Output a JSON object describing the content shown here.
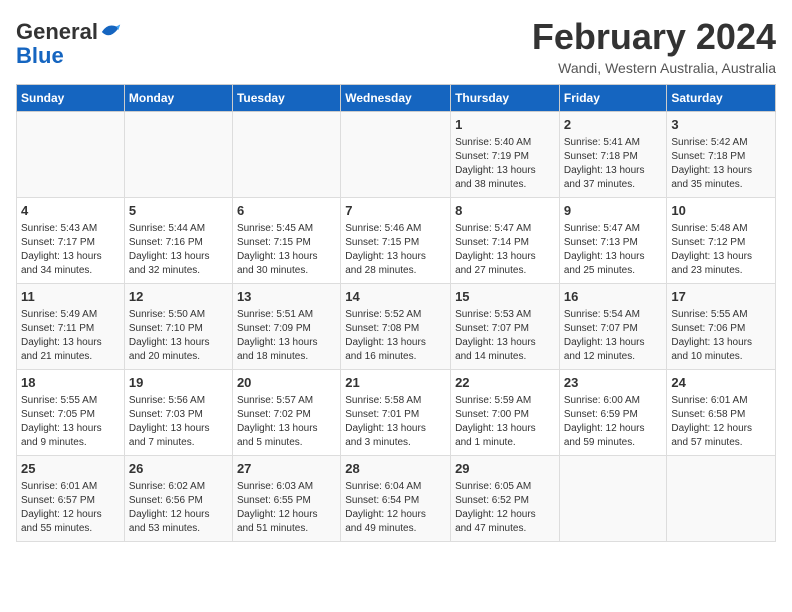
{
  "header": {
    "logo_general": "General",
    "logo_blue": "Blue",
    "month_year": "February 2024",
    "location": "Wandi, Western Australia, Australia"
  },
  "days_of_week": [
    "Sunday",
    "Monday",
    "Tuesday",
    "Wednesday",
    "Thursday",
    "Friday",
    "Saturday"
  ],
  "weeks": [
    [
      {
        "day": "",
        "info": ""
      },
      {
        "day": "",
        "info": ""
      },
      {
        "day": "",
        "info": ""
      },
      {
        "day": "",
        "info": ""
      },
      {
        "day": "1",
        "info": "Sunrise: 5:40 AM\nSunset: 7:19 PM\nDaylight: 13 hours\nand 38 minutes."
      },
      {
        "day": "2",
        "info": "Sunrise: 5:41 AM\nSunset: 7:18 PM\nDaylight: 13 hours\nand 37 minutes."
      },
      {
        "day": "3",
        "info": "Sunrise: 5:42 AM\nSunset: 7:18 PM\nDaylight: 13 hours\nand 35 minutes."
      }
    ],
    [
      {
        "day": "4",
        "info": "Sunrise: 5:43 AM\nSunset: 7:17 PM\nDaylight: 13 hours\nand 34 minutes."
      },
      {
        "day": "5",
        "info": "Sunrise: 5:44 AM\nSunset: 7:16 PM\nDaylight: 13 hours\nand 32 minutes."
      },
      {
        "day": "6",
        "info": "Sunrise: 5:45 AM\nSunset: 7:15 PM\nDaylight: 13 hours\nand 30 minutes."
      },
      {
        "day": "7",
        "info": "Sunrise: 5:46 AM\nSunset: 7:15 PM\nDaylight: 13 hours\nand 28 minutes."
      },
      {
        "day": "8",
        "info": "Sunrise: 5:47 AM\nSunset: 7:14 PM\nDaylight: 13 hours\nand 27 minutes."
      },
      {
        "day": "9",
        "info": "Sunrise: 5:47 AM\nSunset: 7:13 PM\nDaylight: 13 hours\nand 25 minutes."
      },
      {
        "day": "10",
        "info": "Sunrise: 5:48 AM\nSunset: 7:12 PM\nDaylight: 13 hours\nand 23 minutes."
      }
    ],
    [
      {
        "day": "11",
        "info": "Sunrise: 5:49 AM\nSunset: 7:11 PM\nDaylight: 13 hours\nand 21 minutes."
      },
      {
        "day": "12",
        "info": "Sunrise: 5:50 AM\nSunset: 7:10 PM\nDaylight: 13 hours\nand 20 minutes."
      },
      {
        "day": "13",
        "info": "Sunrise: 5:51 AM\nSunset: 7:09 PM\nDaylight: 13 hours\nand 18 minutes."
      },
      {
        "day": "14",
        "info": "Sunrise: 5:52 AM\nSunset: 7:08 PM\nDaylight: 13 hours\nand 16 minutes."
      },
      {
        "day": "15",
        "info": "Sunrise: 5:53 AM\nSunset: 7:07 PM\nDaylight: 13 hours\nand 14 minutes."
      },
      {
        "day": "16",
        "info": "Sunrise: 5:54 AM\nSunset: 7:07 PM\nDaylight: 13 hours\nand 12 minutes."
      },
      {
        "day": "17",
        "info": "Sunrise: 5:55 AM\nSunset: 7:06 PM\nDaylight: 13 hours\nand 10 minutes."
      }
    ],
    [
      {
        "day": "18",
        "info": "Sunrise: 5:55 AM\nSunset: 7:05 PM\nDaylight: 13 hours\nand 9 minutes."
      },
      {
        "day": "19",
        "info": "Sunrise: 5:56 AM\nSunset: 7:03 PM\nDaylight: 13 hours\nand 7 minutes."
      },
      {
        "day": "20",
        "info": "Sunrise: 5:57 AM\nSunset: 7:02 PM\nDaylight: 13 hours\nand 5 minutes."
      },
      {
        "day": "21",
        "info": "Sunrise: 5:58 AM\nSunset: 7:01 PM\nDaylight: 13 hours\nand 3 minutes."
      },
      {
        "day": "22",
        "info": "Sunrise: 5:59 AM\nSunset: 7:00 PM\nDaylight: 13 hours\nand 1 minute."
      },
      {
        "day": "23",
        "info": "Sunrise: 6:00 AM\nSunset: 6:59 PM\nDaylight: 12 hours\nand 59 minutes."
      },
      {
        "day": "24",
        "info": "Sunrise: 6:01 AM\nSunset: 6:58 PM\nDaylight: 12 hours\nand 57 minutes."
      }
    ],
    [
      {
        "day": "25",
        "info": "Sunrise: 6:01 AM\nSunset: 6:57 PM\nDaylight: 12 hours\nand 55 minutes."
      },
      {
        "day": "26",
        "info": "Sunrise: 6:02 AM\nSunset: 6:56 PM\nDaylight: 12 hours\nand 53 minutes."
      },
      {
        "day": "27",
        "info": "Sunrise: 6:03 AM\nSunset: 6:55 PM\nDaylight: 12 hours\nand 51 minutes."
      },
      {
        "day": "28",
        "info": "Sunrise: 6:04 AM\nSunset: 6:54 PM\nDaylight: 12 hours\nand 49 minutes."
      },
      {
        "day": "29",
        "info": "Sunrise: 6:05 AM\nSunset: 6:52 PM\nDaylight: 12 hours\nand 47 minutes."
      },
      {
        "day": "",
        "info": ""
      },
      {
        "day": "",
        "info": ""
      }
    ]
  ]
}
